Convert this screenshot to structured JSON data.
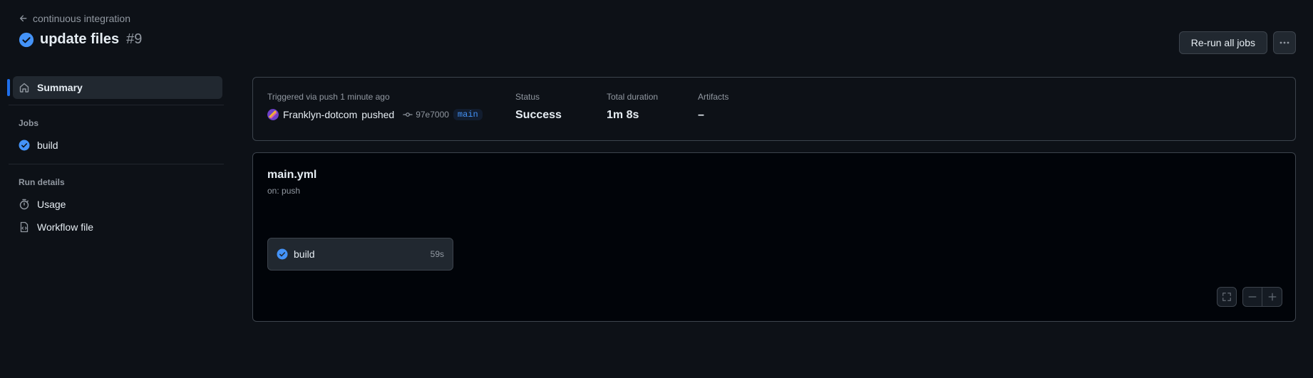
{
  "header": {
    "back_label": "continuous integration",
    "title": "update files",
    "run_number": "#9",
    "rerun_label": "Re-run all jobs"
  },
  "sidebar": {
    "summary_label": "Summary",
    "jobs_heading": "Jobs",
    "jobs": [
      {
        "label": "build",
        "status": "success"
      }
    ],
    "run_details_heading": "Run details",
    "run_details": [
      {
        "label": "Usage",
        "icon": "stopwatch-icon"
      },
      {
        "label": "Workflow file",
        "icon": "file-code-icon"
      }
    ]
  },
  "summary": {
    "trigger_label": "Triggered via push 1 minute ago",
    "actor": "Franklyn-dotcom",
    "action": "pushed",
    "commit": "97e7000",
    "branch": "main",
    "status_label": "Status",
    "status_value": "Success",
    "duration_label": "Total duration",
    "duration_value": "1m 8s",
    "artifacts_label": "Artifacts",
    "artifacts_value": "–"
  },
  "workflow": {
    "file_name": "main.yml",
    "trigger": "on: push",
    "jobs": [
      {
        "name": "build",
        "duration": "59s",
        "status": "success"
      }
    ]
  },
  "colors": {
    "background": "#0d1117",
    "success": "#4493f8",
    "accent": "#1f6feb"
  }
}
